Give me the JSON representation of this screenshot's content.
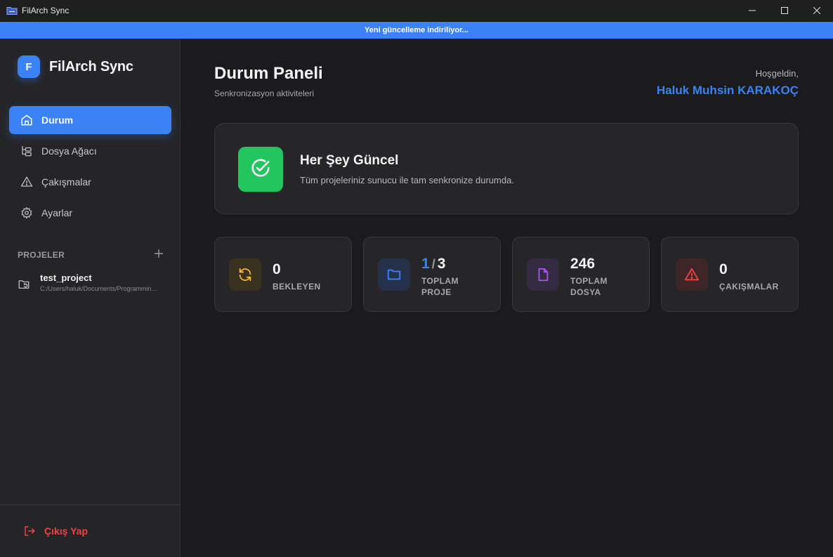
{
  "window": {
    "title": "FilArch Sync",
    "icons": {
      "app": "folder-sync-icon",
      "minimize": "minimize-icon",
      "maximize": "maximize-icon",
      "close": "close-icon"
    }
  },
  "banner": {
    "text": "Yeni güncelleme indiriliyor..."
  },
  "sidebar": {
    "brand": {
      "logo_letter": "F",
      "name": "FilArch Sync"
    },
    "nav": [
      {
        "label": "Durum",
        "icon": "home-icon",
        "active": true
      },
      {
        "label": "Dosya Ağacı",
        "icon": "file-tree-icon",
        "active": false
      },
      {
        "label": "Çakışmalar",
        "icon": "warning-icon",
        "active": false
      },
      {
        "label": "Ayarlar",
        "icon": "gear-icon",
        "active": false
      }
    ],
    "projects": {
      "heading": "PROJELER",
      "add_icon": "plus-icon",
      "items": [
        {
          "name": "test_project",
          "path": "C:/Users/haluk/Documents/Programming/test_project",
          "icon": "folder-sync-icon"
        }
      ]
    },
    "logout": {
      "label": "Çıkış Yap",
      "icon": "logout-icon"
    }
  },
  "main": {
    "title": "Durum Paneli",
    "subtitle": "Senkronizasyon aktiviteleri",
    "welcome": "Hoşgeldin,",
    "username": "Haluk Muhsin KARAKOÇ",
    "status": {
      "title": "Her Şey Güncel",
      "description": "Tüm projeleriniz sunucu ile tam senkronize durumda.",
      "icon": "check-circle-icon"
    },
    "stats": {
      "pending": {
        "value": "0",
        "label": "BEKLEYEN",
        "icon": "refresh-icon"
      },
      "projects": {
        "current": "1",
        "separator": "/",
        "total": "3",
        "label_line1": "TOPLAM",
        "label_line2": "PROJE",
        "icon": "folder-icon"
      },
      "files": {
        "value": "246",
        "label_line1": "TOPLAM",
        "label_line2": "DOSYA",
        "icon": "file-icon"
      },
      "conflicts": {
        "value": "0",
        "label": "ÇAKIŞMALAR",
        "icon": "warning-icon"
      }
    }
  },
  "colors": {
    "accent": "#3b82f6",
    "success": "#22c55e",
    "danger": "#ef4444",
    "pending": "#f5b82e",
    "files": "#a855f7"
  }
}
